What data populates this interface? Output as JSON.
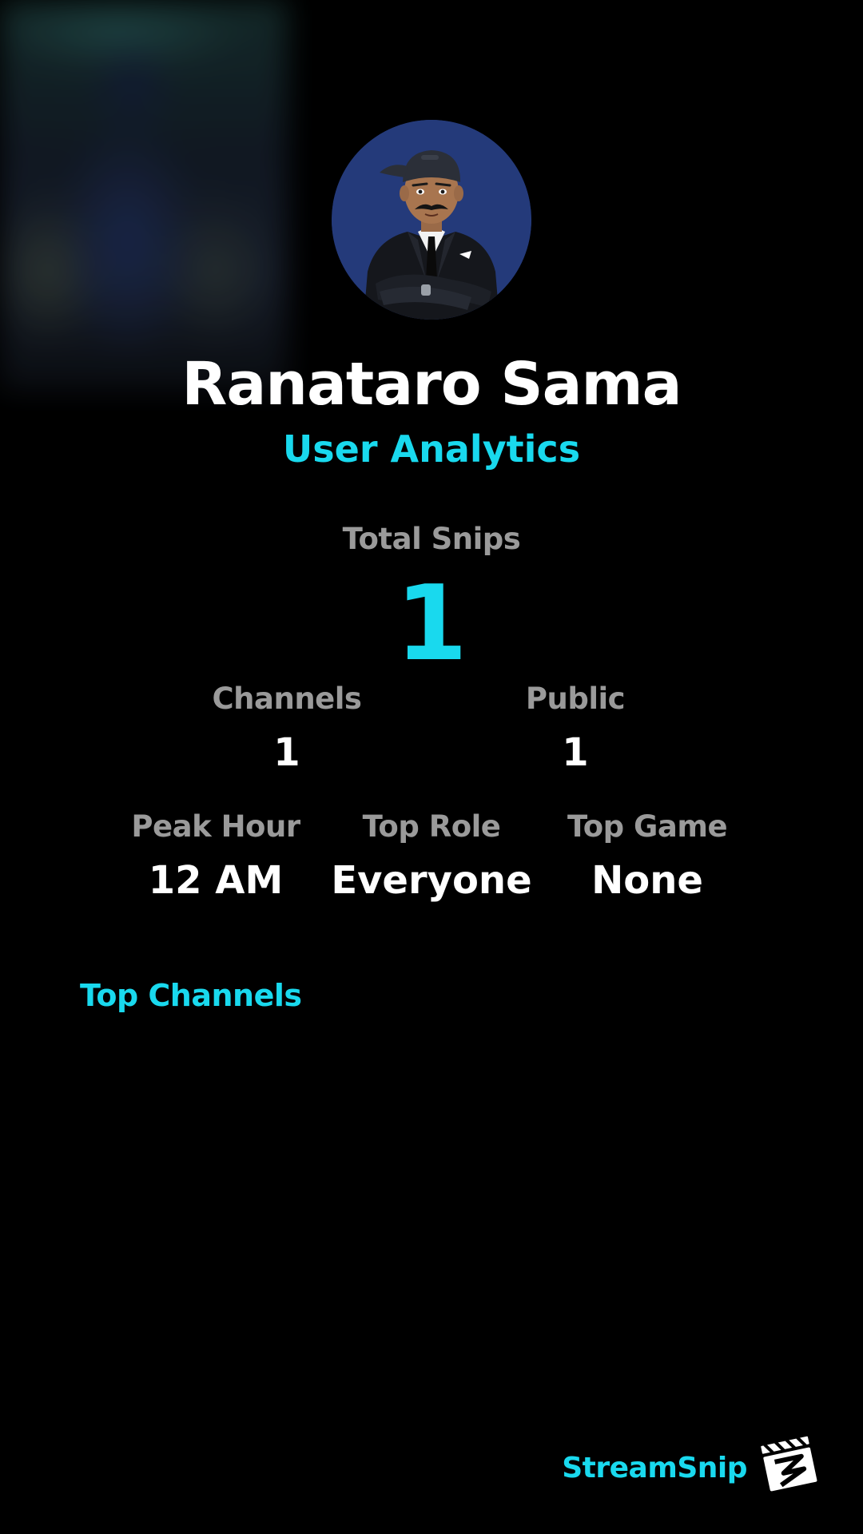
{
  "profile": {
    "name": "Ranataro Sama",
    "subtitle": "User Analytics"
  },
  "stats": {
    "total_snips": {
      "label": "Total Snips",
      "value": "1"
    },
    "channels": {
      "label": "Channels",
      "value": "1"
    },
    "public": {
      "label": "Public",
      "value": "1"
    },
    "peak_hour": {
      "label": "Peak Hour",
      "value": "12 AM"
    },
    "top_role": {
      "label": "Top Role",
      "value": "Everyone"
    },
    "top_game": {
      "label": "Top Game",
      "value": "None"
    }
  },
  "sections": {
    "top_channels_title": "Top Channels"
  },
  "brand": {
    "name": "StreamSnip",
    "logo_icon": "clapperboard-logo-icon"
  },
  "colors": {
    "background": "#000000",
    "accent": "#19d9ee",
    "label": "#9a9a9a",
    "value": "#ffffff",
    "avatar_bg": "#243a7a"
  }
}
